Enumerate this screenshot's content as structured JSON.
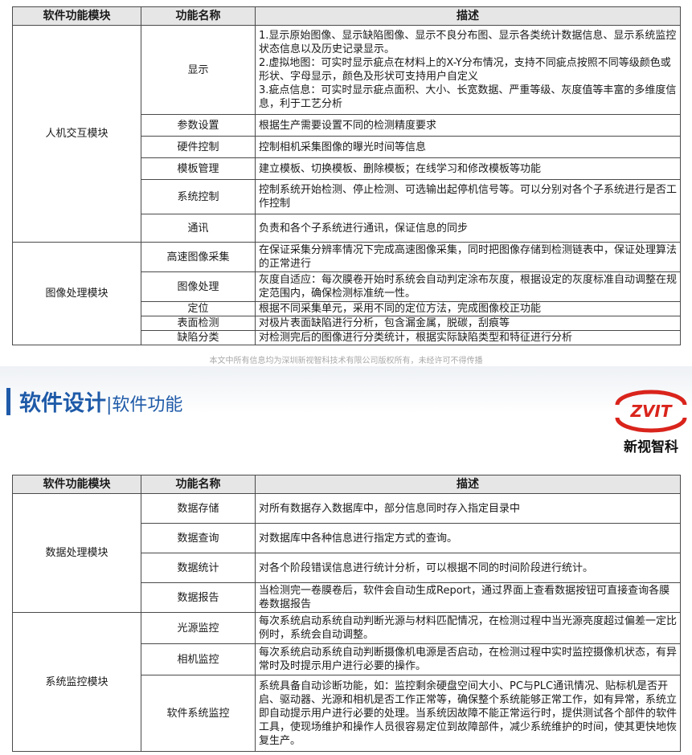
{
  "headers": {
    "module": "软件功能模块",
    "function": "功能名称",
    "description": "描述"
  },
  "table1": {
    "groups": [
      {
        "module": "人机交互模块",
        "rows": [
          {
            "fn": "显示",
            "desc": "1.显示原始图像、显示缺陷图像、显示不良分布图、显示各类统计数据信息、显示系统监控状态信息以及历史记录显示。\n2.虚拟地图：可实时显示疵点在材料上的X-Y分布情况，支持不同疵点按照不同等级颜色或形状、字母显示，颜色及形状可支持用户自定义\n3.疵点信息：可实时显示疵点面积、大小、长宽数据、严重等级、灰度值等丰富的多维度信息，利于工艺分析"
          },
          {
            "fn": "参数设置",
            "desc": "根据生产需要设置不同的检测精度要求"
          },
          {
            "fn": "硬件控制",
            "desc": "控制相机采集图像的曝光时间等信息"
          },
          {
            "fn": "模板管理",
            "desc": "建立模板、切换模板、删除模板；在线学习和修改模板等功能"
          },
          {
            "fn": "系统控制",
            "desc": "控制系统开始检测、停止检测、可选输出起停机信号等。可以分别对各个子系统进行是否工作控制"
          },
          {
            "fn": "通讯",
            "desc": "负责和各个子系统进行通讯，保证信息的同步"
          }
        ]
      },
      {
        "module": "图像处理模块",
        "rows": [
          {
            "fn": "高速图像采集",
            "desc": "在保证采集分辨率情况下完成高速图像采集，同时把图像存储到检测链表中，保证处理算法的正常进行"
          },
          {
            "fn": "图像处理",
            "desc": "灰度自适应：每次膜卷开始时系统会自动判定涂布灰度，根据设定的灰度标准自动调整在规定范围内，确保检测标准统一性。"
          },
          {
            "fn": "定位",
            "desc": "根据不同采集单元，采用不同的定位方法，完成图像校正功能"
          },
          {
            "fn": "表面检测",
            "desc": "对极片表面缺陷进行分析，包含漏金属，脱碳，刮痕等"
          },
          {
            "fn": "缺陷分类",
            "desc": "对检测完后的图像进行分类统计，根据实际缺陷类型和特征进行分析"
          }
        ]
      }
    ]
  },
  "footer_note": "本文中所有信息均为深圳新视智科技术有限公司版权所有，未经许可不得传播",
  "section": {
    "title": "软件设计",
    "separator": "|",
    "subtitle": "软件功能"
  },
  "logo": {
    "mark": "ZVIT",
    "company": "新视智科",
    "color": "#d9241c"
  },
  "table2": {
    "groups": [
      {
        "module": "数据处理模块",
        "rows": [
          {
            "fn": "数据存储",
            "desc": "对所有数据存入数据库中，部分信息同时存入指定目录中"
          },
          {
            "fn": "数据查询",
            "desc": "对数据库中各种信息进行指定方式的查询。"
          },
          {
            "fn": "数据统计",
            "desc": "对各个阶段错误信息进行统计分析，可以根据不同的时间阶段进行统计。"
          },
          {
            "fn": "数据报告",
            "desc": "当检测完一卷膜卷后，软件会自动生成Report，通过界面上查看数据按钮可直接查询各膜卷数据报告"
          }
        ]
      },
      {
        "module": "系统监控模块",
        "rows": [
          {
            "fn": "光源监控",
            "desc": "每次系统启动系统自动判断光源与材料匹配情况，在检测过程中当光源亮度超过偏差一定比例时，系统会自动调整。"
          },
          {
            "fn": "相机监控",
            "desc": "每次系统启动系统自动判断摄像机电源是否启动，在检测过程中实时监控摄像机状态，有异常时及时提示用户进行必要的操作。"
          },
          {
            "fn": "软件系统监控",
            "desc": "系统具备自动诊断功能，如：监控剩余硬盘空间大小、PC与PLC通讯情况、贴标机是否开启、驱动器、光源和相机是否工作正常等，确保整个系统能够正常工作，如有异常，系统立即自动提示用户进行必要的处理。当系统因故障不能正常运行时，提供测试各个部件的软件工具，使现场维护和操作人员很容易定位到故障部件，减少系统维护的时间，使其更快地恢复生产。"
          }
        ]
      }
    ]
  },
  "colors": {
    "accent": "#1e5aa8",
    "header_bg": "#e6e6e6",
    "border": "#4a4a4a"
  }
}
